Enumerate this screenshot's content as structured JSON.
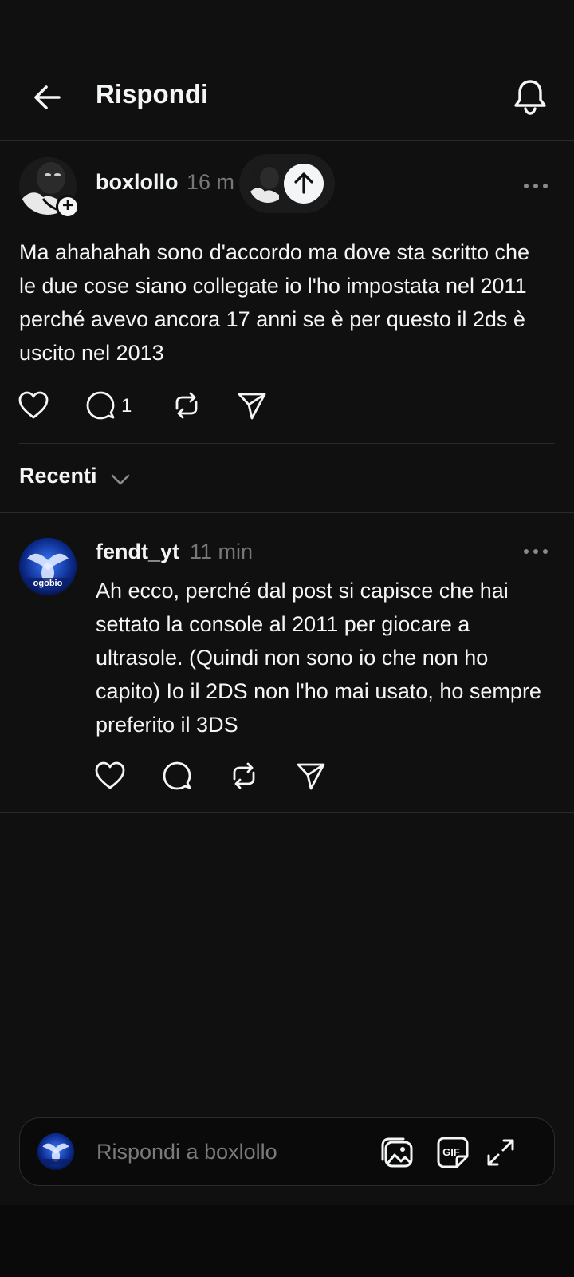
{
  "header": {
    "title": "Rispondi",
    "back_icon": "arrow-left-icon",
    "notifications_icon": "bell-icon"
  },
  "post": {
    "username": "boxlollo",
    "time": "16 m",
    "text": "Ma ahahahah sono d'accordo ma dove sta scritto che le due cose siano collegate io l'ho impostata nel 2011 perché avevo ancora 17 anni se è per questo il 2ds è uscito nel 2013",
    "reply_count": "1"
  },
  "sort": {
    "label": "Recenti"
  },
  "reply": {
    "username": "fendt_yt",
    "time": "11 min",
    "text": "Ah ecco, perché dal post si capisce che hai settato la console al 2011 per giocare a ultrasole. (Quindi non sono io che non ho capito) Io il 2DS non l'ho mai usato, ho sempre preferito il 3DS",
    "avatar_text": "ogobio"
  },
  "composer": {
    "placeholder": "Rispondi a boxlollo",
    "gif_label": "GIF"
  },
  "colors": {
    "background": "#101010",
    "text": "#f3f5f7",
    "muted": "#777777",
    "divider": "#2a2a2a"
  }
}
